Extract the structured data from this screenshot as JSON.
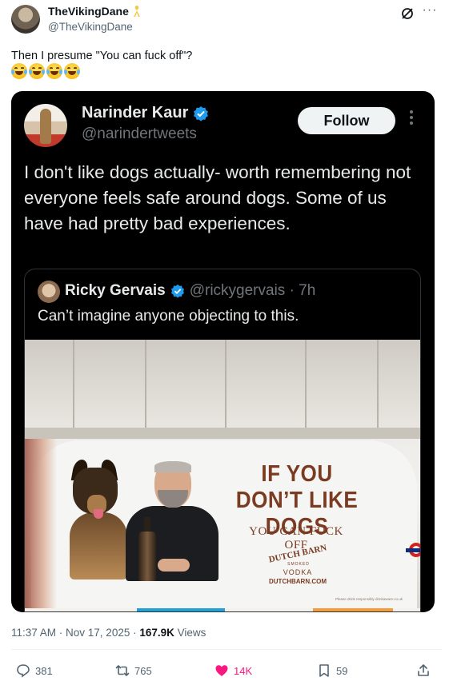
{
  "post": {
    "author_name": "TheVikingDane",
    "author_handle": "@TheVikingDane",
    "text": "Then I presume \"You can fuck off\"?",
    "emoji": [
      "joy",
      "joy",
      "joy",
      "joy"
    ]
  },
  "embedded_tweet": {
    "author_name": "Narinder Kaur",
    "author_handle": "@narindertweets",
    "follow_label": "Follow",
    "text": "I don't like dogs actually- worth remembering not everyone feels safe around dogs. Some of us have had pretty bad experiences.",
    "quoted": {
      "author_name": "Ricky Gervais",
      "author_handle": "@rickygervais · 7h",
      "text": "Can’t imagine anyone objecting to this."
    },
    "ad": {
      "headline": "IF YOU DON’T LIKE DOGS",
      "subline": "YOU CAN FUCK OFF",
      "brand": "DUTCH BARN",
      "brand_sub": "SMOKED",
      "product": "VODKA",
      "url": "DUTCHBARN.COM",
      "fine_print": "Please drink responsibly drinkaware.co.uk"
    }
  },
  "footer": {
    "time": "11:37 AM · Nov 17, 2025 · ",
    "views_count": "167.9K",
    "views_label": " Views"
  },
  "actions": {
    "replies": "381",
    "reposts": "765",
    "likes": "14K",
    "bookmarks": "59"
  },
  "colors": {
    "accent_blue": "#1d9bf0",
    "like_pink": "#f91880",
    "ribbon_gold": "#f7c948"
  },
  "icons": [
    "ribbon-icon",
    "grok-icon",
    "more-icon",
    "verified-icon",
    "reply-icon",
    "repost-icon",
    "like-icon",
    "bookmark-icon",
    "share-icon"
  ]
}
